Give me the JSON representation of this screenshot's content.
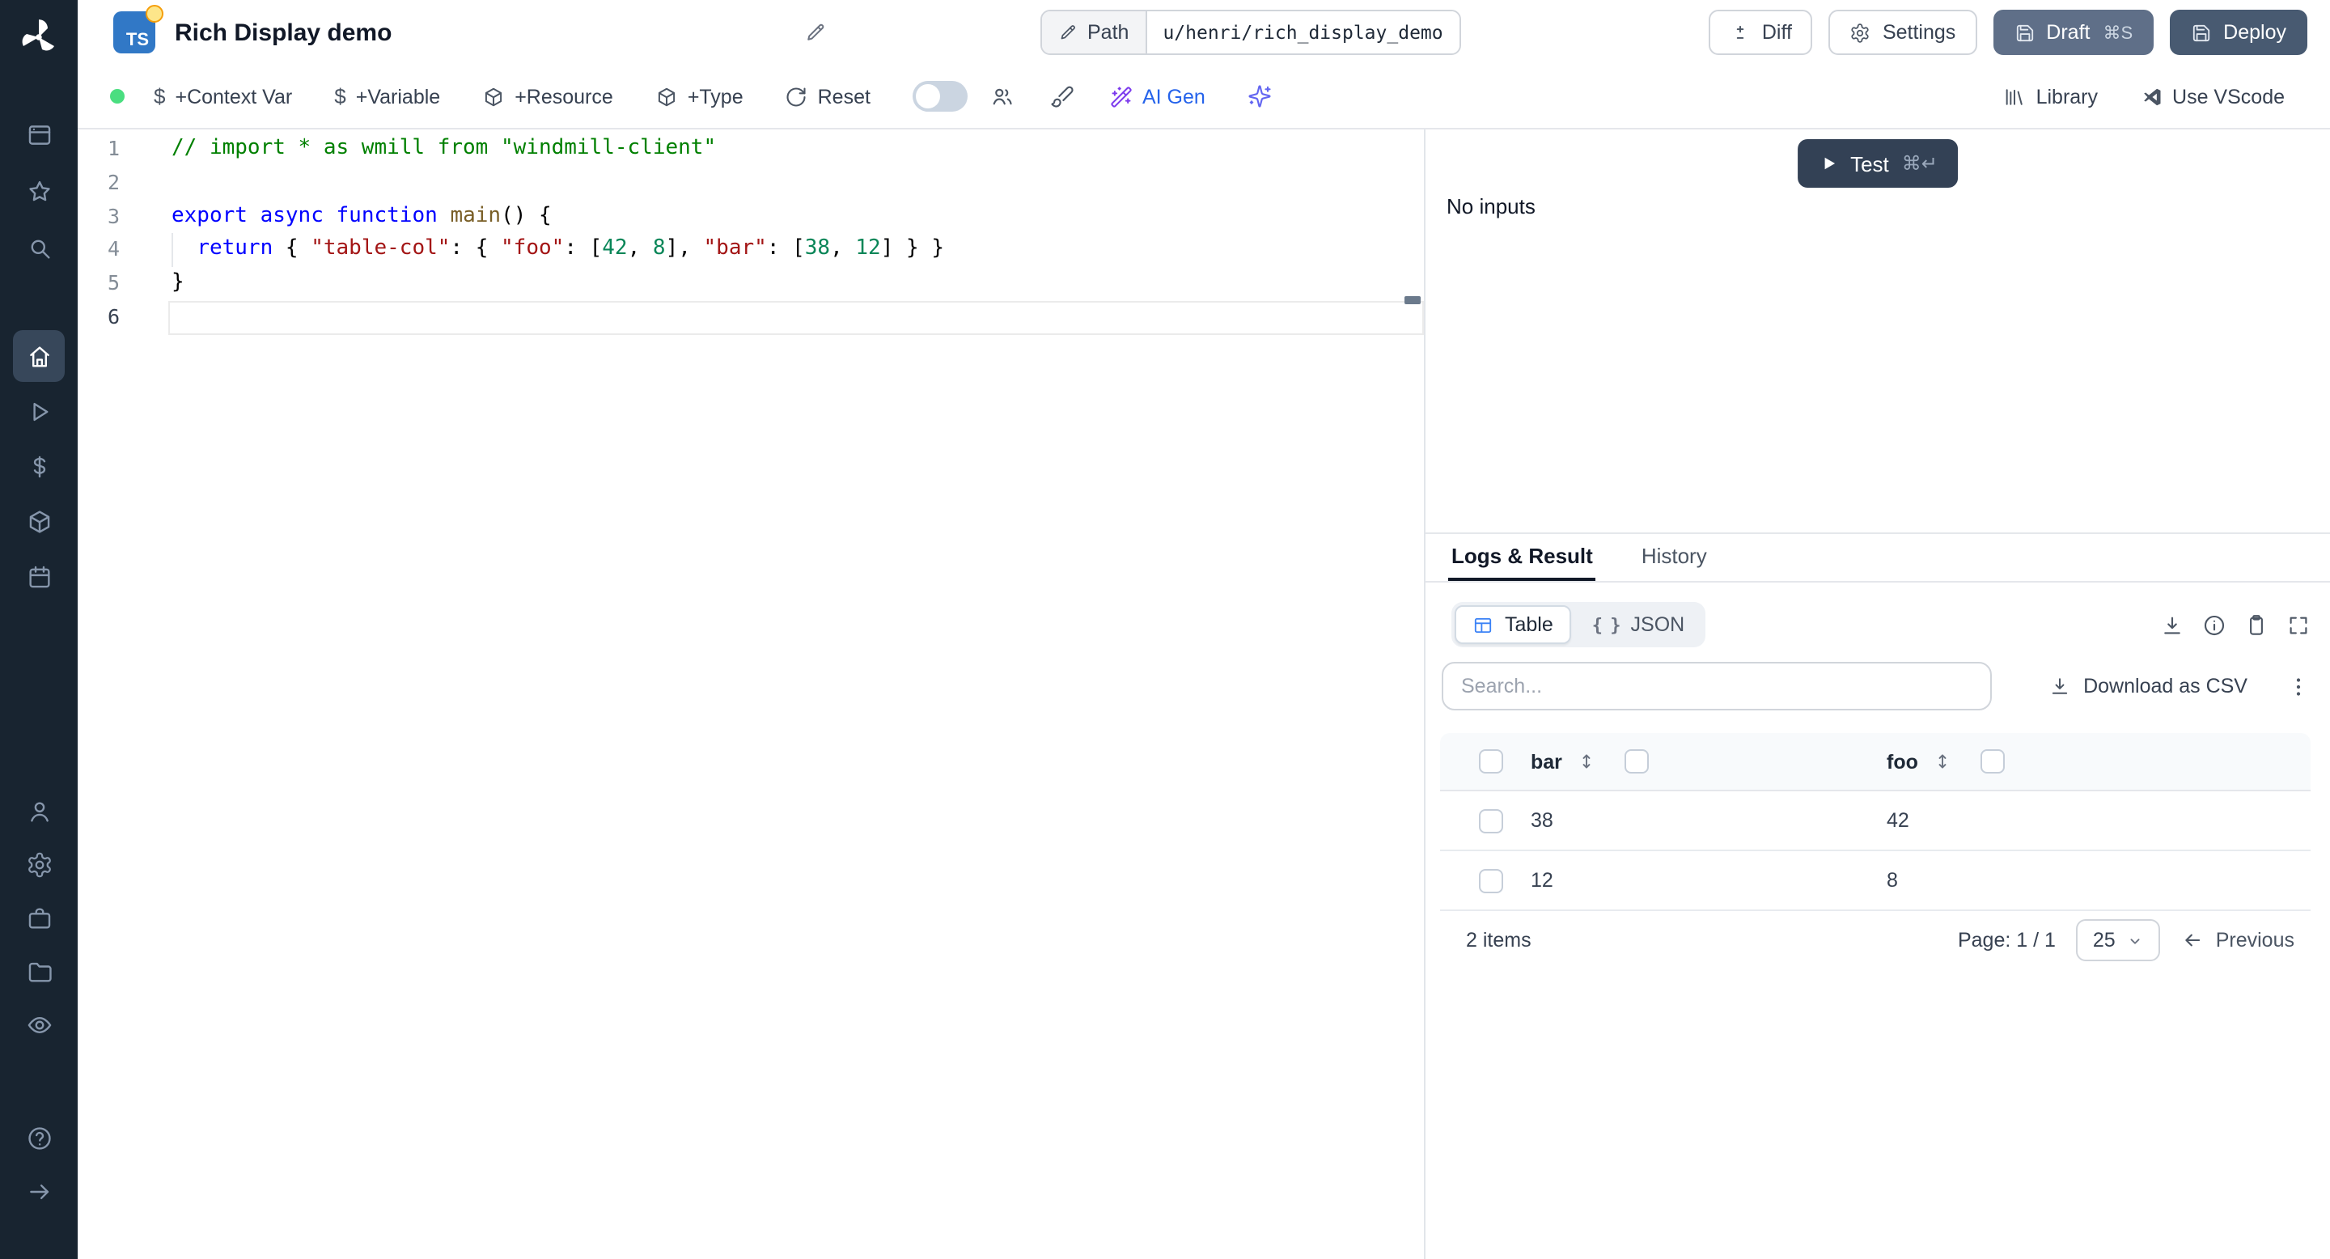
{
  "header": {
    "language_badge": "TS",
    "title": "Rich Display demo",
    "path_label": "Path",
    "path_value": "u/henri/rich_display_demo",
    "diff": "Diff",
    "settings": "Settings",
    "draft": "Draft",
    "draft_shortcut": "⌘S",
    "deploy": "Deploy"
  },
  "toolbar": {
    "context_var": "+Context Var",
    "variable": "+Variable",
    "resource": "+Resource",
    "type": "+Type",
    "reset": "Reset",
    "ai_gen": "AI Gen",
    "library": "Library",
    "use_vscode": "Use VScode"
  },
  "editor": {
    "lines": [
      {
        "num": "1",
        "tokens": [
          [
            "cm",
            "// import * as wmill from \"windmill-client\""
          ]
        ]
      },
      {
        "num": "2",
        "tokens": []
      },
      {
        "num": "3",
        "tokens": [
          [
            "kw",
            "export"
          ],
          [
            "pl",
            " "
          ],
          [
            "kw",
            "async"
          ],
          [
            "pl",
            " "
          ],
          [
            "kw",
            "function"
          ],
          [
            "pl",
            " "
          ],
          [
            "fn",
            "main"
          ],
          [
            "pl",
            "() {"
          ]
        ]
      },
      {
        "num": "4",
        "indent_guide": true,
        "tokens": [
          [
            "pl",
            "  "
          ],
          [
            "kw",
            "return"
          ],
          [
            "pl",
            " { "
          ],
          [
            "st",
            "\"table-col\""
          ],
          [
            "pl",
            ": { "
          ],
          [
            "st",
            "\"foo\""
          ],
          [
            "pl",
            ": ["
          ],
          [
            "nu",
            "42"
          ],
          [
            "pl",
            ", "
          ],
          [
            "nu",
            "8"
          ],
          [
            "pl",
            "], "
          ],
          [
            "st",
            "\"bar\""
          ],
          [
            "pl",
            ": ["
          ],
          [
            "nu",
            "38"
          ],
          [
            "pl",
            ", "
          ],
          [
            "nu",
            "12"
          ],
          [
            "pl",
            "] } }"
          ]
        ]
      },
      {
        "num": "5",
        "tokens": [
          [
            "pl",
            "}"
          ]
        ]
      },
      {
        "num": "6",
        "current": true,
        "tokens": []
      }
    ]
  },
  "run_panel": {
    "test": "Test",
    "test_shortcut": "⌘↵",
    "no_inputs": "No inputs"
  },
  "result_panel": {
    "tabs": [
      {
        "label": "Logs & Result",
        "active": true
      },
      {
        "label": "History",
        "active": false
      }
    ],
    "view_table": "Table",
    "view_json": "JSON",
    "search_placeholder": "Search...",
    "download_csv": "Download as CSV",
    "table": {
      "columns": [
        "bar",
        "foo"
      ],
      "rows": [
        [
          "38",
          "42"
        ],
        [
          "12",
          "8"
        ]
      ]
    },
    "footer": {
      "items": "2 items",
      "page": "Page: 1 / 1",
      "page_size": "25",
      "previous": "Previous"
    }
  },
  "icons": {
    "dollar": "$",
    "json_braces": "{ }",
    "sidebar": [
      "windmill-logo",
      "app-window",
      "favorites-star",
      "search",
      "home",
      "runs-play",
      "variables-dollar",
      "resources-cube",
      "schedules-calendar",
      "workers-user",
      "settings-gear",
      "workspace-briefcase",
      "folders",
      "audit-eye",
      "help",
      "collapse-arrow"
    ]
  },
  "colors": {
    "sidebar_bg": "#182430",
    "accent_blue": "#2563eb",
    "draft_btn": "#5f6f88",
    "deploy_btn": "#485a71",
    "test_btn": "#334155",
    "green_status": "#4ade80",
    "ts_badge": "#3178c6"
  }
}
